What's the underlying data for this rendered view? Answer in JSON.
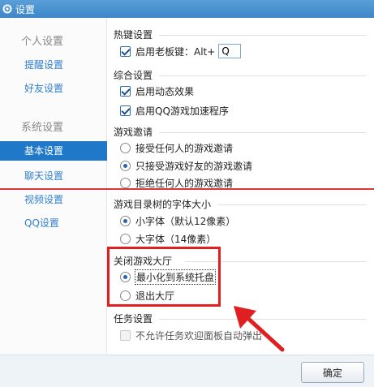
{
  "window": {
    "title": "设置"
  },
  "sidebar": {
    "group_personal": "个人设置",
    "item_reminder": "提醒设置",
    "item_friends": "好友设置",
    "group_system": "系统设置",
    "item_basic": "基本设置",
    "item_chat": "聊天设置",
    "item_video": "视频设置",
    "item_qq": "QQ设置"
  },
  "hotkey": {
    "title": "热键设置",
    "boss_key_label": "启用老板键：Alt+",
    "boss_key_checked": true,
    "boss_key_value": "Q"
  },
  "general": {
    "title": "综合设置",
    "dynamic_effects": "启用动态效果",
    "dynamic_effects_checked": true,
    "qq_game_accelerator": "启用QQ游戏加速程序",
    "qq_game_accelerator_checked": true
  },
  "invite": {
    "title": "游戏邀请",
    "options": [
      "接受任何人的游戏邀请",
      "只接受游戏好友的游戏邀请",
      "拒绝任何人的游戏邀请"
    ],
    "selected_index": 1
  },
  "fontsize": {
    "title": "游戏目录树的字体大小",
    "options": [
      "小字体（默认12像素）",
      "大字体（14像素）"
    ],
    "selected_index": 0
  },
  "close_lobby": {
    "title": "关闭游戏大厅",
    "options": [
      "最小化到系统托盘",
      "退出大厅"
    ],
    "selected_index": 0
  },
  "task": {
    "title": "任务设置",
    "no_popup": "不允许任务欢迎面板自动弹出",
    "no_popup_checked": false
  },
  "footer": {
    "ok_label": "确定"
  },
  "colors": {
    "accent": "#1f78c8",
    "highlight_red": "#e02020"
  }
}
